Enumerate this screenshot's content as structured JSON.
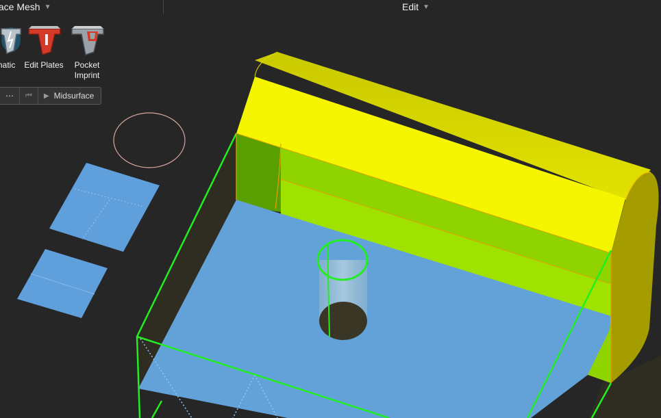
{
  "toolbar": {
    "left_group_title": "face Mesh",
    "edit_group_title": "Edit",
    "tools": [
      {
        "label": "matic",
        "icon": "automatic-midsurface-icon"
      },
      {
        "label": "Edit Plates",
        "icon": "edit-plates-icon"
      },
      {
        "label": "Pocket Imprint",
        "icon": "pocket-imprint-icon"
      }
    ],
    "secondary": {
      "more": "⋯",
      "start_icon": "skip-to-start-icon",
      "play_icon": "play-icon",
      "midsurface_label": "Midsurface"
    }
  },
  "colors": {
    "background": "#262626",
    "yellow_surface": "#f5f500",
    "green_surface": "#8fd400",
    "midsurface_blue": "#62a2d8",
    "selection_green": "#22ee22",
    "circle_outline": "#d8a8a0"
  }
}
